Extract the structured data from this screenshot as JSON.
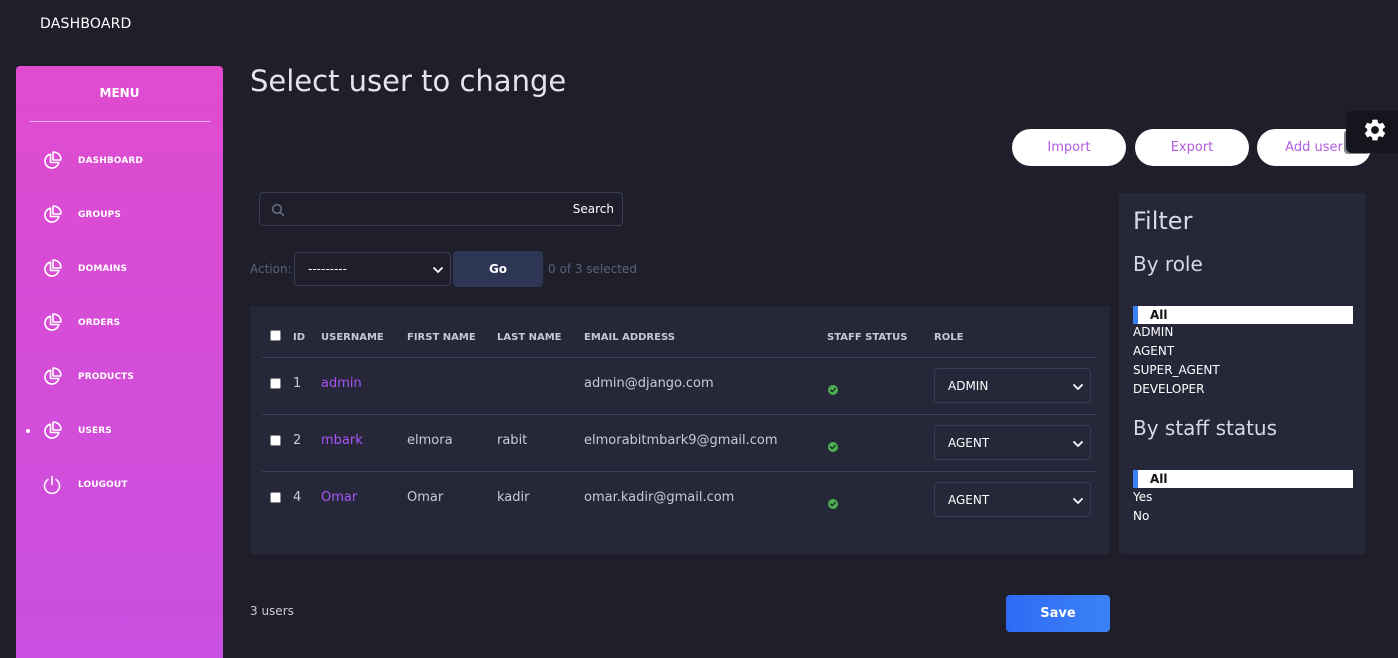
{
  "topbar": {
    "title": "DASHBOARD"
  },
  "sidebar": {
    "title": "MENU",
    "items": [
      {
        "label": "DASHBOARD",
        "icon": "pie-chart-icon",
        "active": false
      },
      {
        "label": "GROUPS",
        "icon": "pie-chart-icon",
        "active": false
      },
      {
        "label": "DOMAINS",
        "icon": "pie-chart-icon",
        "active": false
      },
      {
        "label": "ORDERS",
        "icon": "pie-chart-icon",
        "active": false
      },
      {
        "label": "PRODUCTS",
        "icon": "pie-chart-icon",
        "active": false
      },
      {
        "label": "USERS",
        "icon": "pie-chart-icon",
        "active": true
      },
      {
        "label": "LOUGOUT",
        "icon": "power-icon",
        "active": false
      }
    ]
  },
  "main": {
    "title": "Select user to change",
    "buttons": {
      "import": "Import",
      "export": "Export",
      "add_user": "Add user"
    },
    "search": {
      "button_label": "Search",
      "icon": "search-icon"
    },
    "action": {
      "label": "Action:",
      "selected": "---------",
      "go_label": "Go",
      "selected_count": "0 of 3 selected"
    },
    "table": {
      "headers": [
        "ID",
        "USERNAME",
        "FIRST NAME",
        "LAST NAME",
        "EMAIL ADDRESS",
        "STAFF STATUS",
        "ROLE"
      ],
      "rows": [
        {
          "id": "1",
          "username": "admin",
          "first_name": "",
          "last_name": "",
          "email": "admin@django.com",
          "staff_status": true,
          "role": "ADMIN"
        },
        {
          "id": "2",
          "username": "mbark",
          "first_name": "elmora",
          "last_name": "rabit",
          "email": "elmorabitmbark9@gmail.com",
          "staff_status": true,
          "role": "AGENT"
        },
        {
          "id": "4",
          "username": "Omar",
          "first_name": "Omar",
          "last_name": "kadir",
          "email": "omar.kadir@gmail.com",
          "staff_status": true,
          "role": "AGENT"
        }
      ]
    },
    "footer": {
      "count": "3 users",
      "save_label": "Save"
    }
  },
  "filter": {
    "title": "Filter",
    "by_role": {
      "title": "By role",
      "selected": "All",
      "options": [
        "ADMIN",
        "AGENT",
        "SUPER_AGENT",
        "DEVELOPER"
      ]
    },
    "by_staff": {
      "title": "By staff status",
      "selected": "All",
      "options": [
        "Yes",
        "No"
      ]
    }
  },
  "colors": {
    "background": "#1e1f2b",
    "card": "#262839",
    "sidebar_gradient_top": "#e04bd0",
    "sidebar_gradient_bottom": "#c84fe0",
    "link": "#a855f7",
    "accent_blue": "#3b82f6",
    "success": "#4caf50"
  }
}
